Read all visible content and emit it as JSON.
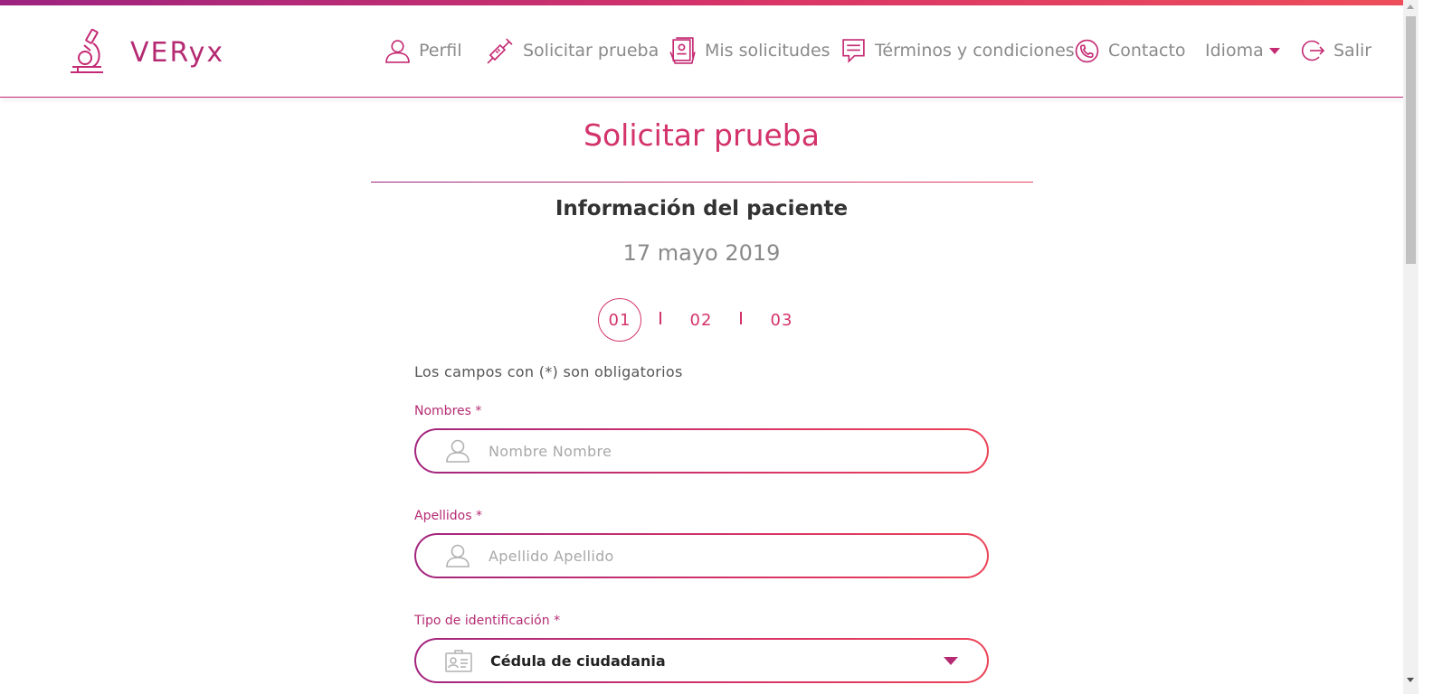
{
  "brand": {
    "name": "VERyx"
  },
  "nav": {
    "items": [
      {
        "label": "Perfil",
        "icon": "user-icon"
      },
      {
        "label": "Solicitar prueba",
        "icon": "syringe-icon"
      },
      {
        "label": "Mis solicitudes",
        "icon": "documents-icon"
      },
      {
        "label": "Términos y condiciones",
        "icon": "message-icon"
      },
      {
        "label": "Contacto",
        "icon": "phone-icon"
      },
      {
        "label": "Idioma",
        "icon": "chevron-down-icon"
      },
      {
        "label": "Salir",
        "icon": "logout-icon"
      }
    ]
  },
  "page": {
    "title": "Solicitar prueba",
    "section_title": "Información del paciente",
    "date": "17 mayo 2019"
  },
  "steps": [
    "01",
    "02",
    "03"
  ],
  "form": {
    "required_note": "Los campos con (*) son obligatorios",
    "nombres": {
      "label": "Nombres *",
      "placeholder": "Nombre Nombre",
      "value": ""
    },
    "apellidos": {
      "label": "Apellidos *",
      "placeholder": "Apellido Apellido",
      "value": ""
    },
    "tipo_identificacion": {
      "label": "Tipo de identificación *",
      "value": "Cédula de ciudadania"
    }
  },
  "colors": {
    "accent": "#d3336b",
    "accent_dark": "#9c2380",
    "muted": "#8a8a8a"
  }
}
